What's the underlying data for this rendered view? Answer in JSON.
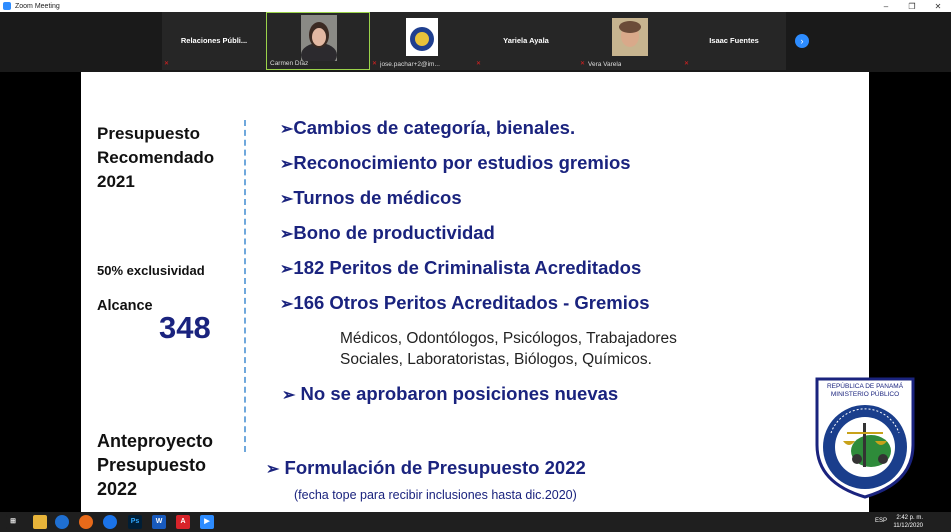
{
  "window": {
    "title": "Zoom Meeting",
    "controls": [
      "–",
      "❐",
      "✕"
    ]
  },
  "participants": [
    {
      "name": "Relaciones Públi...",
      "label": ""
    },
    {
      "name": "",
      "label": "Carmen Díaz",
      "video": true
    },
    {
      "name": "",
      "label": "jose.pachar+2@im...",
      "logo": true
    },
    {
      "name": "Yariela Ayala",
      "label": ""
    },
    {
      "name": "",
      "label": "Vera Varela",
      "photo": true
    },
    {
      "name": "Isaac Fuentes",
      "label": ""
    }
  ],
  "next_icon": "chevron-right-icon",
  "slide": {
    "left": {
      "heading1": [
        "Presupuesto",
        "Recomendado",
        "2021"
      ],
      "exclusividad": "50% exclusividad",
      "alcance_label": "Alcance",
      "alcance_value": "348",
      "heading2": [
        "Anteproyecto",
        "Presupuesto",
        "2022"
      ]
    },
    "bullets": [
      "Cambios de categoría, bienales.",
      "Reconocimiento por estudios gremios",
      "Turnos de médicos",
      "Bono de productividad",
      "182 Peritos de Criminalista Acreditados",
      "166 Otros Peritos Acreditados - Gremios"
    ],
    "sub_line1": "Médicos, Odontólogos, Psicólogos,    Trabajadores",
    "sub_line2": "Sociales, Laboratoristas, Biólogos, Químicos.",
    "bullet_no": "No se aprobaron posiciones nuevas",
    "bullet_form": "Formulación de Presupuesto 2022",
    "note": "(fecha tope para recibir inclusiones hasta dic.2020)",
    "arrow": "➢",
    "seal": {
      "top1": "REPÚBLICA DE PANAMÁ",
      "top2": "MINISTERIO PÚBLICO",
      "ring": "INSTITUTO DE MEDICINA LEGAL Y CIENCIAS FORENSES"
    }
  },
  "taskbar": {
    "language": "ESP",
    "time": "2:42 p. m.",
    "date": "11/12/2020"
  },
  "colors": {
    "accent": "#1a237e",
    "zoom_blue": "#2d8cff",
    "mute_red": "#e02020",
    "active_border": "#9bd34a"
  }
}
